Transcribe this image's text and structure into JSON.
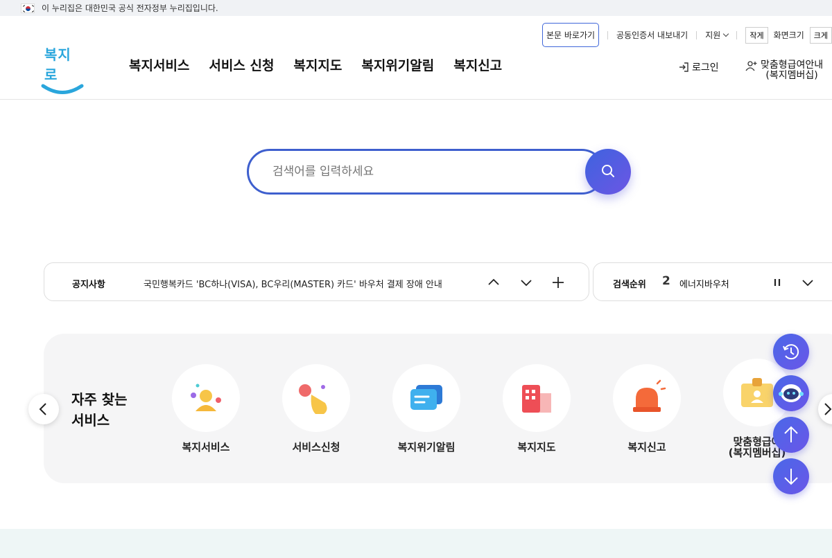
{
  "gov_banner": {
    "text": "이 누리집은 대한민국 공식 전자정부 누리집입니다."
  },
  "utility": {
    "skip_label": "본문 바로가기",
    "cert_label": "공동인증서 내보내기",
    "support_label": "지원",
    "font_small": "작게",
    "font_size_label": "화면크기",
    "font_large": "크게"
  },
  "logo": {
    "text": "복지로"
  },
  "nav": {
    "items": [
      "복지서비스",
      "서비스 신청",
      "복지지도",
      "복지위기알림",
      "복지신고"
    ]
  },
  "user": {
    "login_label": "로그인",
    "member_line1": "맞춤형급여안내",
    "member_line2": "(복지멤버십)"
  },
  "search": {
    "placeholder": "검색어를 입력하세요"
  },
  "notice": {
    "label": "공지사항",
    "text": "국민행복카드 'BC하나(VISA), BC우리(MASTER) 카드' 바우처 결제 장애 안내"
  },
  "ranking": {
    "label": "검색순위",
    "rank": "2",
    "keyword": "에너지바우처"
  },
  "services": {
    "title_line1": "자주 찾는",
    "title_line2": "서비스",
    "items": [
      {
        "label": "복지서비스",
        "icon": "person-icon"
      },
      {
        "label": "서비스신청",
        "icon": "touch-icon"
      },
      {
        "label": "복지위기알림",
        "icon": "message-icon"
      },
      {
        "label": "복지지도",
        "icon": "building-icon"
      },
      {
        "label": "복지신고",
        "icon": "siren-icon"
      },
      {
        "label": "맞춤형급여",
        "label2": "(복지멤버십)",
        "icon": "id-card-icon"
      }
    ]
  },
  "colors": {
    "accent": "#3e5fce",
    "brand": "#2aa6dc",
    "float": "#5a5fe6"
  }
}
